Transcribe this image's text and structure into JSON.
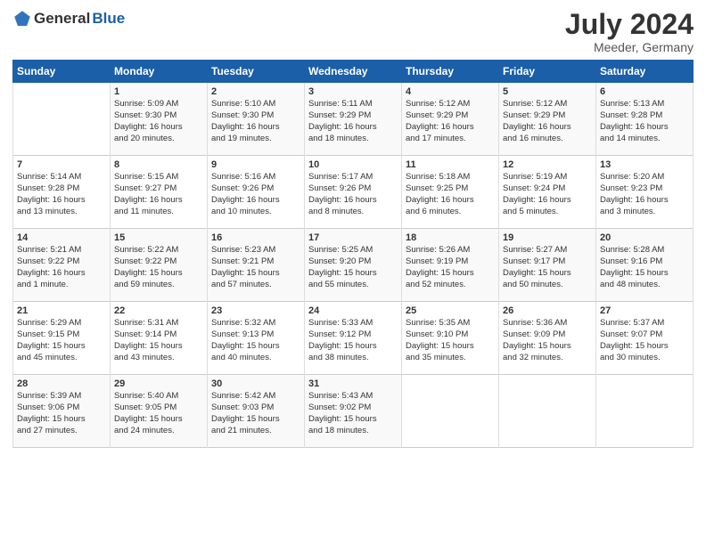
{
  "logo": {
    "general": "General",
    "blue": "Blue"
  },
  "header": {
    "month_year": "July 2024",
    "location": "Meeder, Germany"
  },
  "days_of_week": [
    "Sunday",
    "Monday",
    "Tuesday",
    "Wednesday",
    "Thursday",
    "Friday",
    "Saturday"
  ],
  "weeks": [
    [
      {
        "day": "",
        "content": ""
      },
      {
        "day": "1",
        "content": "Sunrise: 5:09 AM\nSunset: 9:30 PM\nDaylight: 16 hours\nand 20 minutes."
      },
      {
        "day": "2",
        "content": "Sunrise: 5:10 AM\nSunset: 9:30 PM\nDaylight: 16 hours\nand 19 minutes."
      },
      {
        "day": "3",
        "content": "Sunrise: 5:11 AM\nSunset: 9:29 PM\nDaylight: 16 hours\nand 18 minutes."
      },
      {
        "day": "4",
        "content": "Sunrise: 5:12 AM\nSunset: 9:29 PM\nDaylight: 16 hours\nand 17 minutes."
      },
      {
        "day": "5",
        "content": "Sunrise: 5:12 AM\nSunset: 9:29 PM\nDaylight: 16 hours\nand 16 minutes."
      },
      {
        "day": "6",
        "content": "Sunrise: 5:13 AM\nSunset: 9:28 PM\nDaylight: 16 hours\nand 14 minutes."
      }
    ],
    [
      {
        "day": "7",
        "content": "Sunrise: 5:14 AM\nSunset: 9:28 PM\nDaylight: 16 hours\nand 13 minutes."
      },
      {
        "day": "8",
        "content": "Sunrise: 5:15 AM\nSunset: 9:27 PM\nDaylight: 16 hours\nand 11 minutes."
      },
      {
        "day": "9",
        "content": "Sunrise: 5:16 AM\nSunset: 9:26 PM\nDaylight: 16 hours\nand 10 minutes."
      },
      {
        "day": "10",
        "content": "Sunrise: 5:17 AM\nSunset: 9:26 PM\nDaylight: 16 hours\nand 8 minutes."
      },
      {
        "day": "11",
        "content": "Sunrise: 5:18 AM\nSunset: 9:25 PM\nDaylight: 16 hours\nand 6 minutes."
      },
      {
        "day": "12",
        "content": "Sunrise: 5:19 AM\nSunset: 9:24 PM\nDaylight: 16 hours\nand 5 minutes."
      },
      {
        "day": "13",
        "content": "Sunrise: 5:20 AM\nSunset: 9:23 PM\nDaylight: 16 hours\nand 3 minutes."
      }
    ],
    [
      {
        "day": "14",
        "content": "Sunrise: 5:21 AM\nSunset: 9:22 PM\nDaylight: 16 hours\nand 1 minute."
      },
      {
        "day": "15",
        "content": "Sunrise: 5:22 AM\nSunset: 9:22 PM\nDaylight: 15 hours\nand 59 minutes."
      },
      {
        "day": "16",
        "content": "Sunrise: 5:23 AM\nSunset: 9:21 PM\nDaylight: 15 hours\nand 57 minutes."
      },
      {
        "day": "17",
        "content": "Sunrise: 5:25 AM\nSunset: 9:20 PM\nDaylight: 15 hours\nand 55 minutes."
      },
      {
        "day": "18",
        "content": "Sunrise: 5:26 AM\nSunset: 9:19 PM\nDaylight: 15 hours\nand 52 minutes."
      },
      {
        "day": "19",
        "content": "Sunrise: 5:27 AM\nSunset: 9:17 PM\nDaylight: 15 hours\nand 50 minutes."
      },
      {
        "day": "20",
        "content": "Sunrise: 5:28 AM\nSunset: 9:16 PM\nDaylight: 15 hours\nand 48 minutes."
      }
    ],
    [
      {
        "day": "21",
        "content": "Sunrise: 5:29 AM\nSunset: 9:15 PM\nDaylight: 15 hours\nand 45 minutes."
      },
      {
        "day": "22",
        "content": "Sunrise: 5:31 AM\nSunset: 9:14 PM\nDaylight: 15 hours\nand 43 minutes."
      },
      {
        "day": "23",
        "content": "Sunrise: 5:32 AM\nSunset: 9:13 PM\nDaylight: 15 hours\nand 40 minutes."
      },
      {
        "day": "24",
        "content": "Sunrise: 5:33 AM\nSunset: 9:12 PM\nDaylight: 15 hours\nand 38 minutes."
      },
      {
        "day": "25",
        "content": "Sunrise: 5:35 AM\nSunset: 9:10 PM\nDaylight: 15 hours\nand 35 minutes."
      },
      {
        "day": "26",
        "content": "Sunrise: 5:36 AM\nSunset: 9:09 PM\nDaylight: 15 hours\nand 32 minutes."
      },
      {
        "day": "27",
        "content": "Sunrise: 5:37 AM\nSunset: 9:07 PM\nDaylight: 15 hours\nand 30 minutes."
      }
    ],
    [
      {
        "day": "28",
        "content": "Sunrise: 5:39 AM\nSunset: 9:06 PM\nDaylight: 15 hours\nand 27 minutes."
      },
      {
        "day": "29",
        "content": "Sunrise: 5:40 AM\nSunset: 9:05 PM\nDaylight: 15 hours\nand 24 minutes."
      },
      {
        "day": "30",
        "content": "Sunrise: 5:42 AM\nSunset: 9:03 PM\nDaylight: 15 hours\nand 21 minutes."
      },
      {
        "day": "31",
        "content": "Sunrise: 5:43 AM\nSunset: 9:02 PM\nDaylight: 15 hours\nand 18 minutes."
      },
      {
        "day": "",
        "content": ""
      },
      {
        "day": "",
        "content": ""
      },
      {
        "day": "",
        "content": ""
      }
    ]
  ]
}
